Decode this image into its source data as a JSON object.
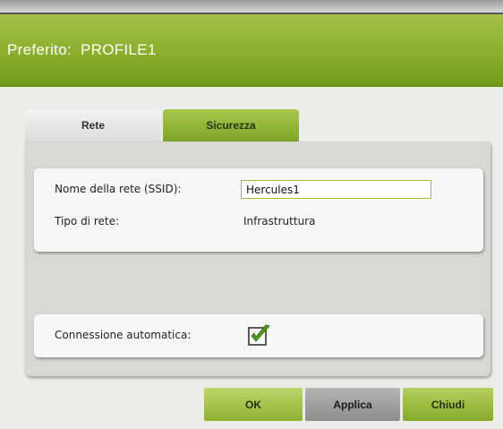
{
  "header": {
    "title_label": "Preferito:",
    "profile_name": "PROFILE1"
  },
  "tabs": [
    {
      "label": "Rete",
      "active": true
    },
    {
      "label": "Sicurezza",
      "active": false
    }
  ],
  "network": {
    "ssid_label": "Nome della rete (SSID):",
    "ssid_value": "Hercules1",
    "type_label": "Tipo di rete:",
    "type_value": "Infrastruttura"
  },
  "auto_connect": {
    "label": "Connessione automatica:",
    "checked": true
  },
  "buttons": {
    "ok": "OK",
    "apply": "Applica",
    "close": "Chiudi"
  },
  "colors": {
    "accent_green": "#8aae2c",
    "panel_gray": "#d8d8d6",
    "check_green": "#4f9a1a"
  }
}
